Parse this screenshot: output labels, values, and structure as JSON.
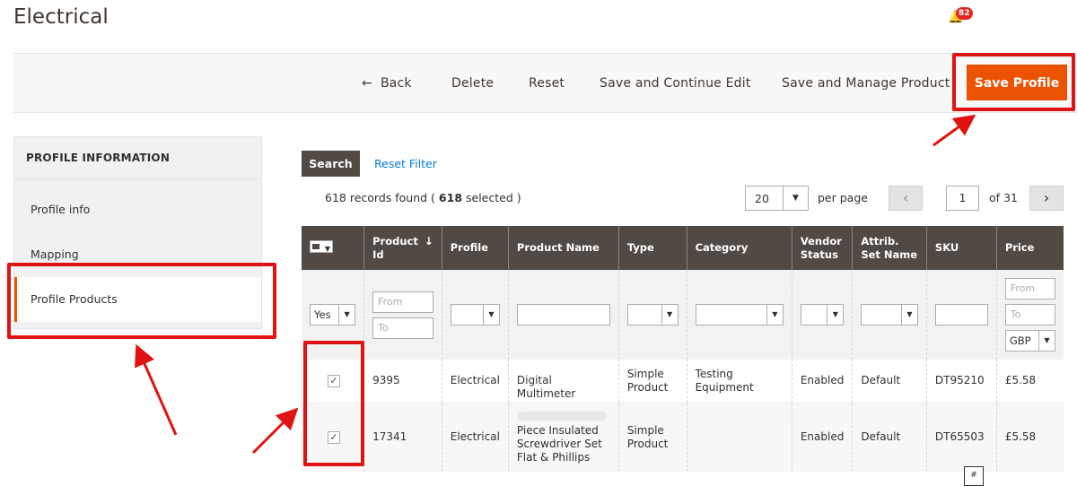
{
  "page": {
    "title": "Electrical",
    "notification_count": "82"
  },
  "actions": {
    "back": "Back",
    "delete": "Delete",
    "reset": "Reset",
    "save_continue": "Save and Continue Edit",
    "save_manage": "Save and Manage Product",
    "save_profile": "Save Profile"
  },
  "sidebar": {
    "heading": "PROFILE INFORMATION",
    "items": [
      {
        "label": "Profile info"
      },
      {
        "label": "Mapping"
      },
      {
        "label": "Profile Products"
      }
    ]
  },
  "grid": {
    "search_label": "Search",
    "reset_filter_label": "Reset Filter",
    "records_prefix": "618 records found (",
    "selected_count": "618",
    "records_suffix": "selected )",
    "per_page_value": "20",
    "per_page_label": "per page",
    "current_page": "1",
    "total_pages_label": "of 31",
    "columns": [
      "Product Id",
      "Profile",
      "Product Name",
      "Type",
      "Category",
      "Vendor Status",
      "Attrib. Set Name",
      "SKU",
      "Price"
    ],
    "filters": {
      "in_profile": "Yes",
      "id_from_placeholder": "From",
      "id_to_placeholder": "To",
      "price_from_placeholder": "From",
      "price_to_placeholder": "To",
      "currency": "GBP"
    },
    "rows": [
      {
        "checked": true,
        "id": "9395",
        "profile": "Electrical",
        "name": "Digital Multimeter",
        "type": "Simple Product",
        "category": "Testing Equipment",
        "vendor_status": "Enabled",
        "attr_set": "Default",
        "sku": "DT95210",
        "price": "£5.58"
      },
      {
        "checked": true,
        "id": "17341",
        "profile": "Electrical",
        "name": "Piece Insulated Screwdriver Set Flat & Phillips",
        "type": "Simple Product",
        "category": "",
        "vendor_status": "Enabled",
        "attr_set": "Default",
        "sku": "DT65503",
        "price": "£5.58"
      }
    ]
  },
  "misc": {
    "hash_label": "#"
  },
  "colors": {
    "accent": "#eb5202",
    "header_dark": "#514943",
    "annotation_red": "#e01313",
    "link_blue": "#007bdb"
  },
  "icons": [
    "bell-icon",
    "back-arrow-icon",
    "chevron-left-icon",
    "chevron-right-icon",
    "sort-down-icon",
    "checkbox-checked-icon",
    "caret-down-icon"
  ]
}
